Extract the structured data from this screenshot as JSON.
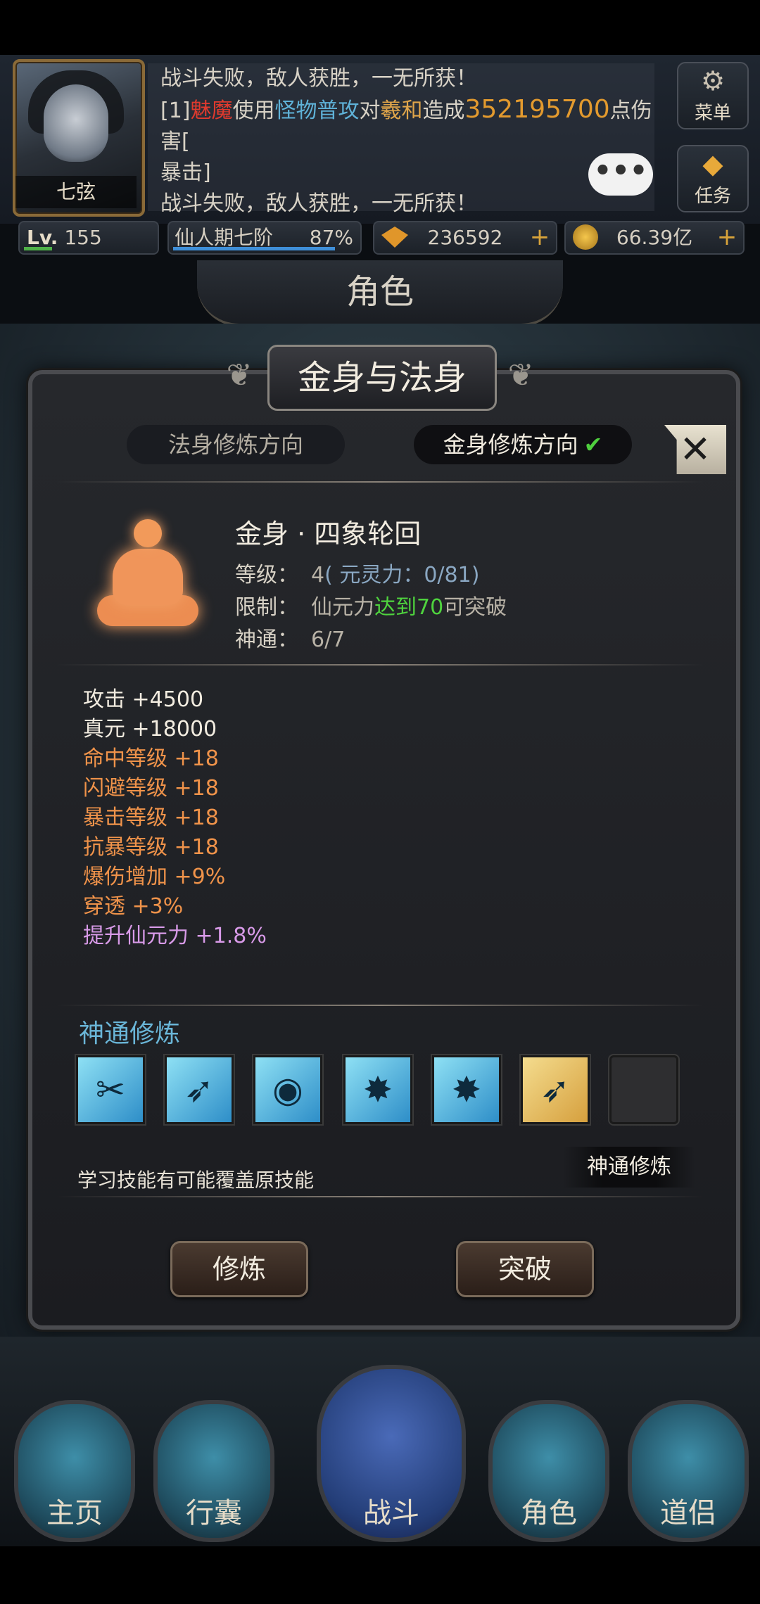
{
  "player": {
    "name": "七弦",
    "level_label": "Lv.",
    "level": "155",
    "realm": "仙人期七阶",
    "realm_progress": "87%",
    "gems": "236592",
    "gold": "66.39亿"
  },
  "log": {
    "line1": "战斗失败，敌人获胜，一无所获！",
    "line2_prefix": "[1]",
    "line2_enemy": "魅魔",
    "line2_use": "使用",
    "line2_skill": "怪物普攻",
    "line2_to": "对",
    "line2_target": "羲和",
    "line2_cause": "造成",
    "line2_damage": "352195700",
    "line2_suffix": "点伤害[",
    "line3": "暴击]",
    "line4": "战斗失败，敌人获胜，一无所获！",
    "chat": "•••"
  },
  "side_buttons": {
    "menu": "菜单",
    "task": "任务"
  },
  "page_title": "角色",
  "panel": {
    "title": "金身与法身",
    "tab_fa": "法身修炼方向",
    "tab_jin": "金身修炼方向",
    "check": "✔",
    "close": "✕",
    "name": "金身 · 四象轮回",
    "level_label": "等级：",
    "level_value": "4",
    "level_note": "( 元灵力：0/81)",
    "limit_label": "限制：",
    "limit_a": "仙元力",
    "limit_b": "达到70",
    "limit_c": "可突破",
    "shentong_label": "神通：",
    "shentong_value": "6/7"
  },
  "attributes": [
    {
      "name": "攻击",
      "value": "+4500"
    },
    {
      "name": "真元",
      "value": "+18000"
    },
    {
      "name": "命中等级",
      "value": "+18"
    },
    {
      "name": "闪避等级",
      "value": "+18"
    },
    {
      "name": "暴击等级",
      "value": "+18"
    },
    {
      "name": "抗暴等级",
      "value": "+18"
    },
    {
      "name": "爆伤增加",
      "value": "+9%"
    },
    {
      "name": "穿透",
      "value": "+3%"
    },
    {
      "name": "提升仙元力",
      "value": "+1.8%"
    }
  ],
  "skills": {
    "title": "神通修炼",
    "hint": "学习技能有可能覆盖原技能",
    "train_button": "神通修炼"
  },
  "actions": {
    "train": "修炼",
    "breakthrough": "突破"
  },
  "nav": {
    "home": "主页",
    "bag": "行囊",
    "battle": "战斗",
    "role": "角色",
    "companion": "道侣"
  }
}
